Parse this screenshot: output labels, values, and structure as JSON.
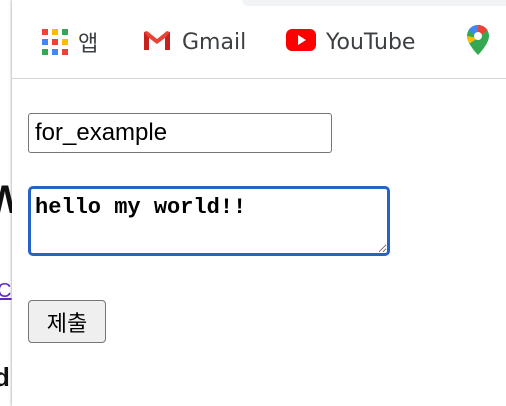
{
  "bookmarks": [
    {
      "label": "앱",
      "icon": "apps-grid-icon"
    },
    {
      "label": "Gmail",
      "icon": "gmail-icon"
    },
    {
      "label": "YouTube",
      "icon": "youtube-icon"
    },
    {
      "label": "",
      "icon": "google-maps-icon"
    }
  ],
  "form": {
    "text_input_value": "for_example",
    "textarea_value": "hello my world!!",
    "submit_label": "제출"
  },
  "colors": {
    "focus_ring": "#2563c9",
    "gmail_red": "#ea4335",
    "youtube_red": "#ff0000",
    "visited_link": "#5b2bbd"
  }
}
